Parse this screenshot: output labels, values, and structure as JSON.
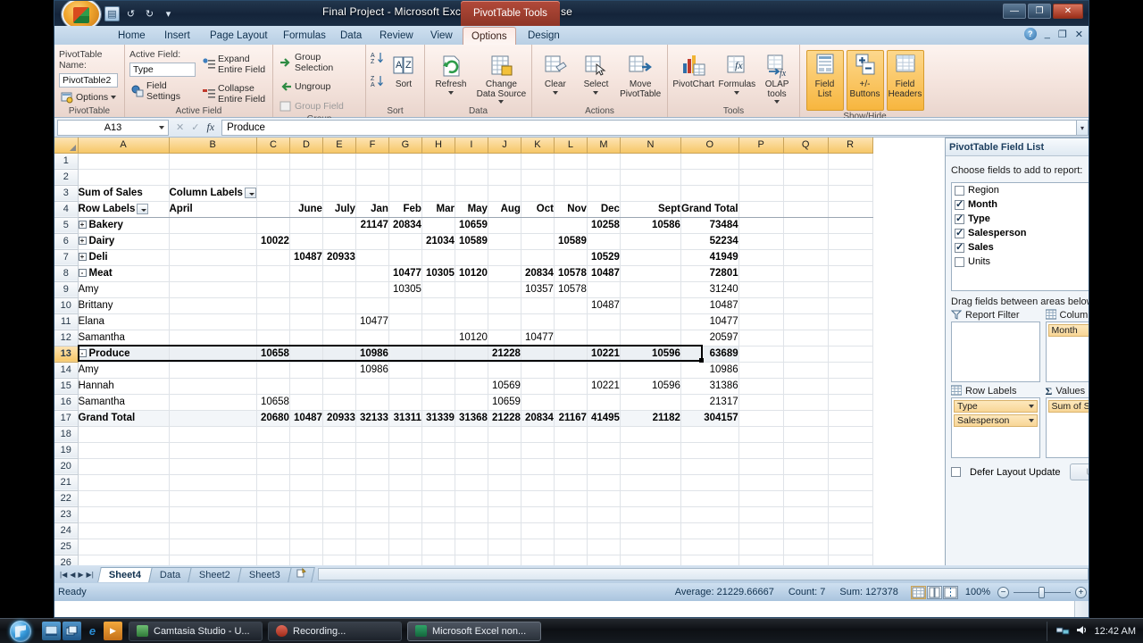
{
  "window": {
    "title": "Final Project - Microsoft Excel non-commercial use",
    "contextual_tab_group": "PivotTable Tools",
    "minimize": "—",
    "restore": "❐",
    "close": "✕"
  },
  "quick_access": [
    {
      "name": "save-icon",
      "glyph": "▤"
    },
    {
      "name": "undo-icon",
      "glyph": "↺"
    },
    {
      "name": "redo-icon",
      "glyph": "↻"
    },
    {
      "name": "customize-qat-icon",
      "glyph": "▾"
    }
  ],
  "ribbon_tabs": [
    {
      "label": "Home",
      "active": false
    },
    {
      "label": "Insert",
      "active": false
    },
    {
      "label": "Page Layout",
      "active": false
    },
    {
      "label": "Formulas",
      "active": false
    },
    {
      "label": "Data",
      "active": false
    },
    {
      "label": "Review",
      "active": false
    },
    {
      "label": "View",
      "active": false
    },
    {
      "label": "Options",
      "active": true
    },
    {
      "label": "Design",
      "active": false
    }
  ],
  "window_controls_inner": {
    "help": "?",
    "minimize": "_",
    "restore": "❐",
    "close": "✕"
  },
  "ribbon": {
    "pivottable": {
      "group_title": "PivotTable",
      "name_label": "PivotTable Name:",
      "name_value": "PivotTable2",
      "options_label": "Options"
    },
    "active_field": {
      "group_title": "Active Field",
      "label": "Active Field:",
      "value": "Type",
      "field_settings": "Field Settings",
      "expand": "Expand Entire Field",
      "collapse": "Collapse Entire Field"
    },
    "group": {
      "group_title": "Group",
      "group_selection": "Group Selection",
      "ungroup": "Ungroup",
      "group_field": "Group Field"
    },
    "sort": {
      "group_title": "Sort",
      "sort_label": "Sort"
    },
    "data": {
      "group_title": "Data",
      "refresh": "Refresh",
      "change_data_source": "Change Data Source"
    },
    "actions": {
      "group_title": "Actions",
      "clear": "Clear",
      "select": "Select",
      "move": "Move PivotTable"
    },
    "tools": {
      "group_title": "Tools",
      "pivotchart": "PivotChart",
      "formulas": "Formulas",
      "olap": "OLAP tools"
    },
    "showhide": {
      "group_title": "Show/Hide",
      "field_list": "Field List",
      "plus_minus": "+/- Buttons",
      "field_headers": "Field Headers"
    }
  },
  "formula_bar": {
    "name_box": "A13",
    "cancel_icon": "✕",
    "enter_icon": "✓",
    "fx": "fx",
    "content": "Produce",
    "expand_icon": "▾"
  },
  "grid": {
    "columns": [
      "A",
      "B",
      "C",
      "D",
      "E",
      "F",
      "G",
      "H",
      "I",
      "J",
      "K",
      "L",
      "M",
      "N",
      "O",
      "P",
      "Q",
      "R"
    ],
    "rows": [
      1,
      2,
      3,
      4,
      5,
      6,
      7,
      8,
      9,
      10,
      11,
      12,
      13,
      14,
      15,
      16,
      17,
      18,
      19,
      20,
      21,
      22,
      23,
      24,
      25,
      26,
      27
    ],
    "selected_row": 13,
    "pivot": {
      "title_cell": "Sum of Sales",
      "column_labels": "Column Labels",
      "row_labels": "Row Labels",
      "headers": [
        "April",
        "",
        "June",
        "July",
        "Jan",
        "Feb",
        "Mar",
        "May",
        "Aug",
        "Oct",
        "Nov",
        "Dec",
        "Sept",
        "Grand Total"
      ],
      "data_rows": [
        {
          "row": 5,
          "label": "Bakery",
          "level": 0,
          "expander": "+",
          "values": [
            "",
            "",
            "",
            "",
            "21147",
            "20834",
            "",
            "10659",
            "",
            "",
            "",
            "10258",
            "10586",
            "73484"
          ]
        },
        {
          "row": 6,
          "label": "Dairy",
          "level": 0,
          "expander": "+",
          "values": [
            "",
            "10022",
            "",
            "",
            "",
            "",
            "21034",
            "10589",
            "",
            "",
            "10589",
            "",
            "",
            "52234"
          ]
        },
        {
          "row": 7,
          "label": "Deli",
          "level": 0,
          "expander": "+",
          "values": [
            "",
            "",
            "10487",
            "20933",
            "",
            "",
            "",
            "",
            "",
            "",
            "",
            "10529",
            "",
            "41949"
          ]
        },
        {
          "row": 8,
          "label": "Meat",
          "level": 0,
          "expander": "-",
          "values": [
            "",
            "",
            "",
            "",
            "",
            "10477",
            "10305",
            "10120",
            "",
            "20834",
            "10578",
            "10487",
            "",
            "72801"
          ]
        },
        {
          "row": 9,
          "label": "Amy",
          "level": 1,
          "expander": "",
          "values": [
            "",
            "",
            "",
            "",
            "",
            "10305",
            "",
            "",
            "",
            "10357",
            "10578",
            "",
            "",
            "31240"
          ]
        },
        {
          "row": 10,
          "label": "Brittany",
          "level": 1,
          "expander": "",
          "values": [
            "",
            "",
            "",
            "",
            "",
            "",
            "",
            "",
            "",
            "",
            "",
            "10487",
            "",
            "10487"
          ]
        },
        {
          "row": 11,
          "label": "Elana",
          "level": 1,
          "expander": "",
          "values": [
            "",
            "",
            "",
            "",
            "10477",
            "",
            "",
            "",
            "",
            "",
            "",
            "",
            "",
            "10477"
          ]
        },
        {
          "row": 12,
          "label": "Samantha",
          "level": 1,
          "expander": "",
          "values": [
            "",
            "",
            "",
            "",
            "",
            "",
            "",
            "10120",
            "",
            "10477",
            "",
            "",
            "",
            "20597"
          ]
        },
        {
          "row": 13,
          "label": "Produce",
          "level": 0,
          "expander": "-",
          "values": [
            "",
            "10658",
            "",
            "",
            "10986",
            "",
            "",
            "",
            "21228",
            "",
            "",
            "10221",
            "10596",
            "63689"
          ],
          "selected": true
        },
        {
          "row": 14,
          "label": "Amy",
          "level": 1,
          "expander": "",
          "values": [
            "",
            "",
            "",
            "",
            "10986",
            "",
            "",
            "",
            "",
            "",
            "",
            "",
            "",
            "10986"
          ]
        },
        {
          "row": 15,
          "label": "Hannah",
          "level": 1,
          "expander": "",
          "values": [
            "",
            "",
            "",
            "",
            "",
            "",
            "",
            "",
            "10569",
            "",
            "",
            "10221",
            "10596",
            "31386"
          ]
        },
        {
          "row": 16,
          "label": "Samantha",
          "level": 1,
          "expander": "",
          "values": [
            "",
            "10658",
            "",
            "",
            "",
            "",
            "",
            "",
            "10659",
            "",
            "",
            "",
            "",
            "21317"
          ]
        }
      ],
      "grand_total": {
        "row": 17,
        "label": "Grand Total",
        "values": [
          "",
          "20680",
          "10487",
          "20933",
          "32133",
          "31311",
          "31339",
          "31368",
          "21228",
          "20834",
          "21167",
          "41495",
          "21182",
          "304157"
        ]
      }
    }
  },
  "field_list": {
    "title": "PivotTable Field List",
    "menu_icon": "▾",
    "close_icon": "✕",
    "subtitle": "Choose fields to add to report:",
    "tool_icon": "field-layout-icon",
    "tool_caret": "▾",
    "fields": [
      {
        "label": "Region",
        "checked": false
      },
      {
        "label": "Month",
        "checked": true
      },
      {
        "label": "Type",
        "checked": true
      },
      {
        "label": "Salesperson",
        "checked": true
      },
      {
        "label": "Sales",
        "checked": true
      },
      {
        "label": "Units",
        "checked": false
      }
    ],
    "drag_hint": "Drag fields between areas below:",
    "zones": [
      {
        "name": "Report Filter",
        "icon": "filter-icon",
        "chips": []
      },
      {
        "name": "Column Labels",
        "icon": "grid-icon",
        "chips": [
          "Month"
        ]
      },
      {
        "name": "Row Labels",
        "icon": "grid-icon",
        "chips": [
          "Type",
          "Salesperson"
        ]
      },
      {
        "name": "Values",
        "icon": "sigma-icon",
        "chips": [
          "Sum of Sales"
        ]
      }
    ],
    "defer_label": "Defer Layout Update",
    "update_label": "Update"
  },
  "sheet_tabs": {
    "nav": [
      "|◀",
      "◀",
      "▶",
      "▶|"
    ],
    "tabs": [
      {
        "label": "Sheet4",
        "active": true
      },
      {
        "label": "Data",
        "active": false
      },
      {
        "label": "Sheet2",
        "active": false
      },
      {
        "label": "Sheet3",
        "active": false
      }
    ],
    "insert_tab_icon": "new-sheet-icon"
  },
  "status_bar": {
    "mode": "Ready",
    "average": "Average: 21229.66667",
    "count": "Count: 7",
    "sum": "Sum: 127378",
    "views": [
      "normal-view-icon",
      "page-layout-icon",
      "page-break-icon"
    ],
    "zoom": "100%",
    "zoom_out": "−",
    "zoom_in": "+"
  },
  "taskbar": {
    "start": "start-orb",
    "quicklaunch": [
      {
        "name": "show-desktop-icon",
        "glyph": "▭"
      },
      {
        "name": "switch-window-icon",
        "glyph": "❐"
      },
      {
        "name": "internet-explorer-icon",
        "glyph": "e"
      },
      {
        "name": "media-player-icon",
        "glyph": "▶"
      }
    ],
    "buttons": [
      {
        "label": "Camtasia Studio - U...",
        "active": false,
        "icon_color": "#3f8f45"
      },
      {
        "label": "Recording...",
        "active": false,
        "icon_color": "#c0392b"
      },
      {
        "label": "Microsoft Excel non...",
        "active": true,
        "icon_color": "#1d7044"
      }
    ],
    "tray": [
      {
        "name": "network-icon",
        "glyph": "🖧"
      },
      {
        "name": "volume-icon",
        "glyph": "🔊"
      }
    ],
    "clock": "12:42 AM"
  }
}
